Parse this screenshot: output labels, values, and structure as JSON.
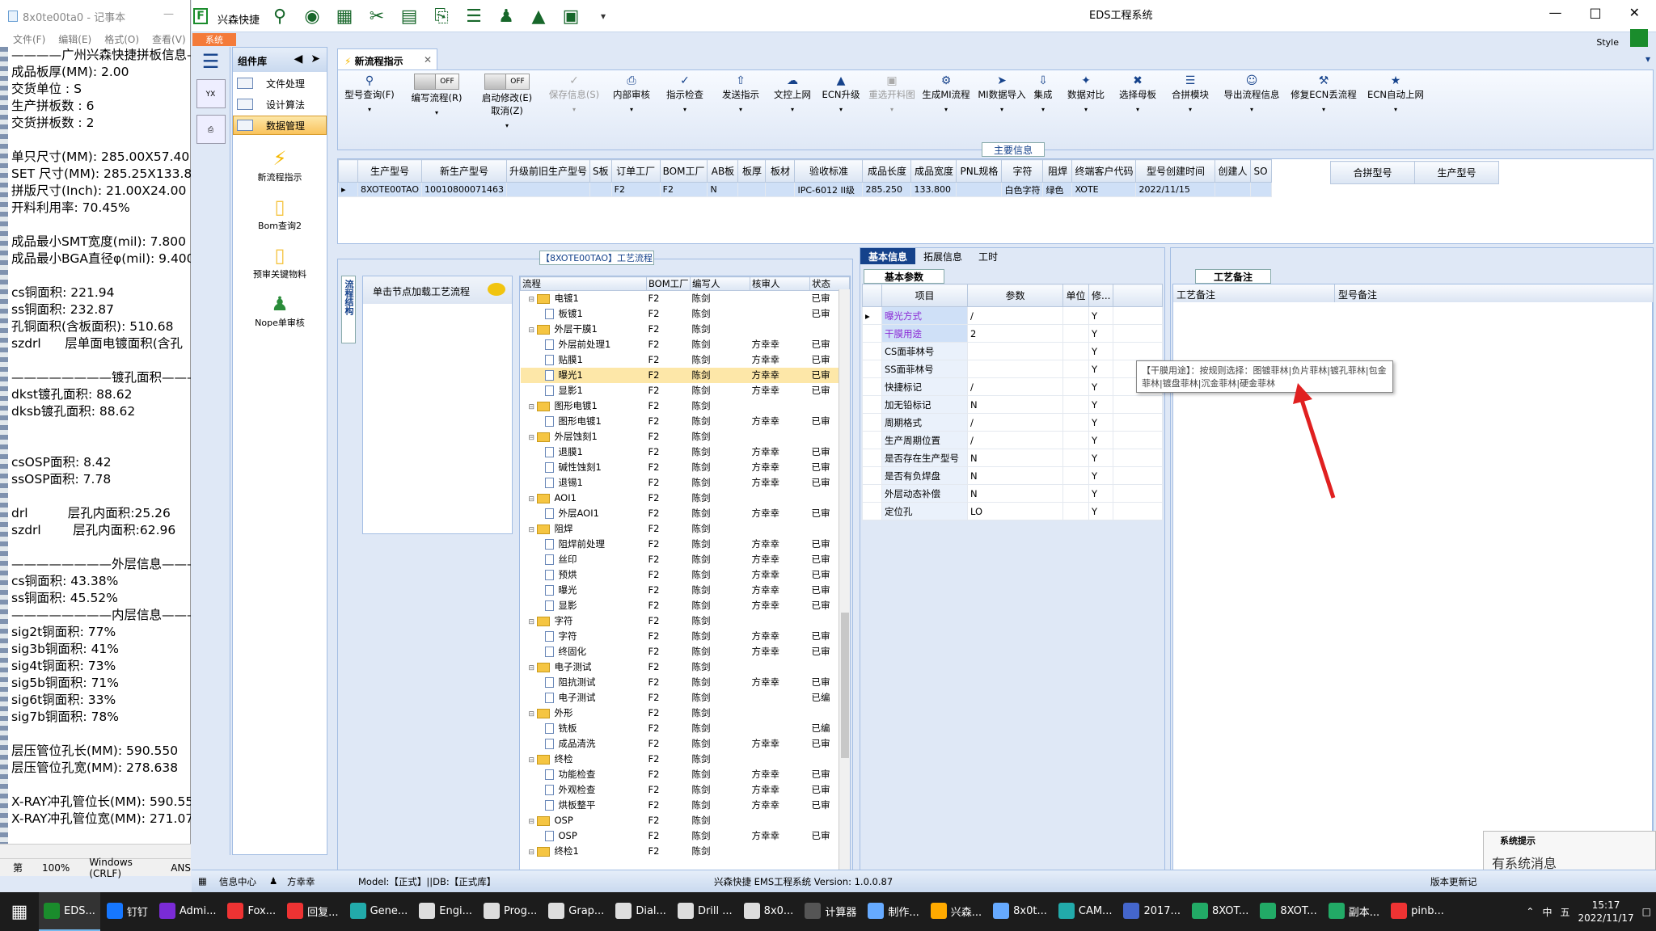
{
  "notepad": {
    "title": "8x0te00ta0 - 记事本",
    "menu": [
      "文件(F)",
      "编辑(E)",
      "格式(O)",
      "查看(V)"
    ],
    "lines": [
      "————广州兴森快捷拼板信息—",
      "成品板厚(MM): 2.00",
      "交货单位 : S",
      "生产拼板数 : 6",
      "交货拼板数 : 2",
      "",
      "单只尺寸(MM): 285.00X57.40",
      "SET 尺寸(MM): 285.25X133.80",
      "拼版尺寸(Inch): 21.00X24.00",
      "开料利用率: 70.45%",
      "",
      "成品最小SMT宽度(mil): 7.800",
      "成品最小BGA直径φ(mil): 9.400",
      "",
      "cs铜面积: 221.94",
      "ss铜面积: 232.87",
      "孔铜面积(含板面积): 510.68",
      "szdrl      层单面电镀面积(含孔",
      "",
      "————————镀孔面积——————",
      "dkst镀孔面积: 88.62",
      "dksb镀孔面积: 88.62",
      "",
      "",
      "csOSP面积: 8.42",
      "ssOSP面积: 7.78",
      "",
      "drl          层孔内面积:25.26",
      "szdrl        层孔内面积:62.96",
      "",
      "————————外层信息——————",
      "cs铜面积: 43.38%",
      "ss铜面积: 45.52%",
      "————————内层信息——————",
      "sig2t铜面积: 77%",
      "sig3b铜面积: 41%",
      "sig4t铜面积: 73%",
      "sig5b铜面积: 71%",
      "sig6t铜面积: 33%",
      "sig7b铜面积: 78%",
      "",
      "层压管位孔长(MM): 590.550",
      "层压管位孔宽(MM): 278.638",
      "",
      "X-RAY冲孔管位长(MM): 590.55",
      "X-RAY冲孔管位宽(MM): 271.07"
    ],
    "status": [
      "第",
      "100%",
      "Windows (CRLF)",
      "ANS"
    ]
  },
  "app": {
    "name": "兴森快捷",
    "window_title": "EDS工程系统",
    "style_label": "Style",
    "sys_tab": "系统",
    "component_lib": "组件库",
    "nav_items": [
      "文件处理",
      "设计算法",
      "数据管理"
    ],
    "tools": [
      "新流程指示",
      "Bom查询2",
      "预审关键物料",
      "Nope单审核"
    ],
    "main_tab": "新流程指示",
    "ribbon": [
      {
        "label": "型号查询(F)",
        "icon": "search-icon"
      },
      {
        "label": "编写流程(R)",
        "toggle": "OFF"
      },
      {
        "label": "启动修改(E)",
        "label2": "取消(Z)",
        "toggle": "OFF"
      },
      {
        "label": "保存信息(S)",
        "disabled": true
      },
      {
        "label": "内部审核"
      },
      {
        "label": "指示检查"
      },
      {
        "label": "发送指示"
      },
      {
        "label": "文控上网"
      },
      {
        "label": "ECN升级"
      },
      {
        "label": "重选开料图",
        "disabled": true
      },
      {
        "label": "生成MI流程"
      },
      {
        "label": "MI数据导入"
      },
      {
        "label": "集成"
      },
      {
        "label": "数据对比"
      },
      {
        "label": "选择母板"
      },
      {
        "label": "合拼模块"
      },
      {
        "label": "导出流程信息"
      },
      {
        "label": "修复ECN丢流程"
      },
      {
        "label": "ECN自动上网"
      }
    ],
    "main_info_title": "主要信息",
    "main_grid": {
      "headers": [
        "生产型号",
        "新生产型号",
        "升级前旧生产型号",
        "S板",
        "订单工厂",
        "BOM工厂",
        "AB板",
        "板厚",
        "板材",
        "验收标准",
        "成品长度",
        "成品宽度",
        "PNL规格",
        "字符",
        "阻焊",
        "终端客户代码",
        "型号创建时间",
        "创建人",
        "SO"
      ],
      "row": [
        "8XOTE00TAO",
        "10010800071463",
        "",
        "",
        "F2",
        "F2",
        "N",
        "",
        "",
        "IPC-6012 II级",
        "285.250",
        "133.800",
        "",
        "白色字符",
        "绿色",
        "XOTE",
        "2022/11/15",
        "",
        ""
      ]
    },
    "merge_headers": [
      "合拼型号",
      "生产型号"
    ],
    "process_title": "【8XOTE00TAO】工艺流程",
    "side_tab": "流程结构",
    "node_hint": "单击节点加载工艺流程",
    "tree_headers": [
      "流程",
      "BOM工厂",
      "编写人",
      "核审人",
      "状态"
    ],
    "tree": [
      {
        "lvl": 0,
        "name": "电镀1",
        "f": "F2",
        "w": "陈剑",
        "r": "",
        "s": "已审"
      },
      {
        "lvl": 1,
        "name": "板镀1",
        "f": "F2",
        "w": "陈剑",
        "r": "",
        "s": "已审"
      },
      {
        "lvl": 0,
        "name": "外层干膜1",
        "f": "F2",
        "w": "陈剑",
        "r": "",
        "s": ""
      },
      {
        "lvl": 1,
        "name": "外层前处理1",
        "f": "F2",
        "w": "陈剑",
        "r": "方幸幸",
        "s": "已审"
      },
      {
        "lvl": 1,
        "name": "贴膜1",
        "f": "F2",
        "w": "陈剑",
        "r": "方幸幸",
        "s": "已审"
      },
      {
        "lvl": 1,
        "name": "曝光1",
        "f": "F2",
        "w": "陈剑",
        "r": "方幸幸",
        "s": "已审",
        "hl": true
      },
      {
        "lvl": 1,
        "name": "显影1",
        "f": "F2",
        "w": "陈剑",
        "r": "方幸幸",
        "s": "已审"
      },
      {
        "lvl": 0,
        "name": "图形电镀1",
        "f": "F2",
        "w": "陈剑",
        "r": "",
        "s": ""
      },
      {
        "lvl": 1,
        "name": "图形电镀1",
        "f": "F2",
        "w": "陈剑",
        "r": "方幸幸",
        "s": "已审"
      },
      {
        "lvl": 0,
        "name": "外层蚀刻1",
        "f": "F2",
        "w": "陈剑",
        "r": "",
        "s": ""
      },
      {
        "lvl": 1,
        "name": "退膜1",
        "f": "F2",
        "w": "陈剑",
        "r": "方幸幸",
        "s": "已审"
      },
      {
        "lvl": 1,
        "name": "碱性蚀刻1",
        "f": "F2",
        "w": "陈剑",
        "r": "方幸幸",
        "s": "已审"
      },
      {
        "lvl": 1,
        "name": "退锡1",
        "f": "F2",
        "w": "陈剑",
        "r": "方幸幸",
        "s": "已审"
      },
      {
        "lvl": 0,
        "name": "AOI1",
        "f": "F2",
        "w": "陈剑",
        "r": "",
        "s": ""
      },
      {
        "lvl": 1,
        "name": "外层AOI1",
        "f": "F2",
        "w": "陈剑",
        "r": "方幸幸",
        "s": "已审"
      },
      {
        "lvl": 0,
        "name": "阻焊",
        "f": "F2",
        "w": "陈剑",
        "r": "",
        "s": ""
      },
      {
        "lvl": 1,
        "name": "阻焊前处理",
        "f": "F2",
        "w": "陈剑",
        "r": "方幸幸",
        "s": "已审"
      },
      {
        "lvl": 1,
        "name": "丝印",
        "f": "F2",
        "w": "陈剑",
        "r": "方幸幸",
        "s": "已审"
      },
      {
        "lvl": 1,
        "name": "预烘",
        "f": "F2",
        "w": "陈剑",
        "r": "方幸幸",
        "s": "已审"
      },
      {
        "lvl": 1,
        "name": "曝光",
        "f": "F2",
        "w": "陈剑",
        "r": "方幸幸",
        "s": "已审"
      },
      {
        "lvl": 1,
        "name": "显影",
        "f": "F2",
        "w": "陈剑",
        "r": "方幸幸",
        "s": "已审"
      },
      {
        "lvl": 0,
        "name": "字符",
        "f": "F2",
        "w": "陈剑",
        "r": "",
        "s": ""
      },
      {
        "lvl": 1,
        "name": "字符",
        "f": "F2",
        "w": "陈剑",
        "r": "方幸幸",
        "s": "已审"
      },
      {
        "lvl": 1,
        "name": "终固化",
        "f": "F2",
        "w": "陈剑",
        "r": "方幸幸",
        "s": "已审"
      },
      {
        "lvl": 0,
        "name": "电子测试",
        "f": "F2",
        "w": "陈剑",
        "r": "",
        "s": ""
      },
      {
        "lvl": 1,
        "name": "阻抗测试",
        "f": "F2",
        "w": "陈剑",
        "r": "方幸幸",
        "s": "已审"
      },
      {
        "lvl": 1,
        "name": "电子测试",
        "f": "F2",
        "w": "陈剑",
        "r": "",
        "s": "已编"
      },
      {
        "lvl": 0,
        "name": "外形",
        "f": "F2",
        "w": "陈剑",
        "r": "",
        "s": ""
      },
      {
        "lvl": 1,
        "name": "铣板",
        "f": "F2",
        "w": "陈剑",
        "r": "",
        "s": "已编"
      },
      {
        "lvl": 1,
        "name": "成品清洗",
        "f": "F2",
        "w": "陈剑",
        "r": "方幸幸",
        "s": "已审"
      },
      {
        "lvl": 0,
        "name": "终检",
        "f": "F2",
        "w": "陈剑",
        "r": "",
        "s": ""
      },
      {
        "lvl": 1,
        "name": "功能检查",
        "f": "F2",
        "w": "陈剑",
        "r": "方幸幸",
        "s": "已审"
      },
      {
        "lvl": 1,
        "name": "外观检查",
        "f": "F2",
        "w": "陈剑",
        "r": "方幸幸",
        "s": "已审"
      },
      {
        "lvl": 1,
        "name": "烘板整平",
        "f": "F2",
        "w": "陈剑",
        "r": "方幸幸",
        "s": "已审"
      },
      {
        "lvl": 0,
        "name": "OSP",
        "f": "F2",
        "w": "陈剑",
        "r": "",
        "s": ""
      },
      {
        "lvl": 1,
        "name": "OSP",
        "f": "F2",
        "w": "陈剑",
        "r": "方幸幸",
        "s": "已审"
      },
      {
        "lvl": 0,
        "name": "终检1",
        "f": "F2",
        "w": "陈剑",
        "r": "",
        "s": ""
      }
    ],
    "basic_tabs": [
      "基本信息",
      "拓展信息",
      "工时"
    ],
    "basic_params_title": "基本参数",
    "param_headers": [
      "项目",
      "参数",
      "单位",
      "修..."
    ],
    "params": [
      {
        "k": "曝光方式",
        "v": "/",
        "f": "Y",
        "sel": true
      },
      {
        "k": "干膜用途",
        "v": "2",
        "f": "Y",
        "sel": true
      },
      {
        "k": "CS面菲林号",
        "v": "",
        "f": "Y"
      },
      {
        "k": "SS面菲林号",
        "v": "",
        "f": "Y"
      },
      {
        "k": "快捷标记",
        "v": "/",
        "f": "Y"
      },
      {
        "k": "加无铅标记",
        "v": "N",
        "f": "Y"
      },
      {
        "k": "周期格式",
        "v": "/",
        "f": "Y"
      },
      {
        "k": "生产周期位置",
        "v": "/",
        "f": "Y"
      },
      {
        "k": "是否存在生产型号",
        "v": "N",
        "f": "Y"
      },
      {
        "k": "是否有负焊盘",
        "v": "N",
        "f": "Y"
      },
      {
        "k": "外层动态补偿",
        "v": "N",
        "f": "Y"
      },
      {
        "k": "定位孔",
        "v": "LO",
        "f": "Y"
      }
    ],
    "tooltip": "【干膜用途】：按规则选择：图镀菲林|负片菲林|镀孔菲林|包金菲林|镀盘菲林|沉金菲林|硬金菲林",
    "notes_title": "工艺备注",
    "notes_cols": [
      "工艺备注",
      "型号备注"
    ],
    "sys_notice_title": "系统提示",
    "sys_notice_text": "有系统消息",
    "status": {
      "info_center": "信息中心",
      "user": "方幸幸",
      "model_db": "Model:【正式】||DB:【正式库】",
      "version": "兴森快捷 EMS工程系统 Version: 1.0.0.87",
      "release": "版本更新记"
    }
  },
  "taskbar": {
    "items": [
      {
        "label": "EDS...",
        "color": "#1a8c2c",
        "active": true
      },
      {
        "label": "钉钉",
        "color": "#1677ff"
      },
      {
        "label": "Admi...",
        "color": "#7a2bd6"
      },
      {
        "label": "Fox...",
        "color": "#e33"
      },
      {
        "label": "回复...",
        "color": "#e33"
      },
      {
        "label": "Gene...",
        "color": "#2aa"
      },
      {
        "label": "Engi...",
        "color": "#ddd"
      },
      {
        "label": "Prog...",
        "color": "#ddd"
      },
      {
        "label": "Grap...",
        "color": "#ddd"
      },
      {
        "label": "Dial...",
        "color": "#ddd"
      },
      {
        "label": "Drill ...",
        "color": "#ddd"
      },
      {
        "label": "8x0...",
        "color": "#ddd"
      },
      {
        "label": "计算器",
        "color": "#555"
      },
      {
        "label": "制作...",
        "color": "#6af"
      },
      {
        "label": "兴森...",
        "color": "#fa0"
      },
      {
        "label": "8x0t...",
        "color": "#6af"
      },
      {
        "label": "CAM...",
        "color": "#2aa"
      },
      {
        "label": "2017...",
        "color": "#46c"
      },
      {
        "label": "8XOT...",
        "color": "#2a6"
      },
      {
        "label": "8XOT...",
        "color": "#2a6"
      },
      {
        "label": "副本...",
        "color": "#2a6"
      },
      {
        "label": "pinb...",
        "color": "#e33"
      }
    ],
    "tray": [
      "中",
      "五"
    ],
    "time": "15:17",
    "date": "2022/11/17"
  }
}
